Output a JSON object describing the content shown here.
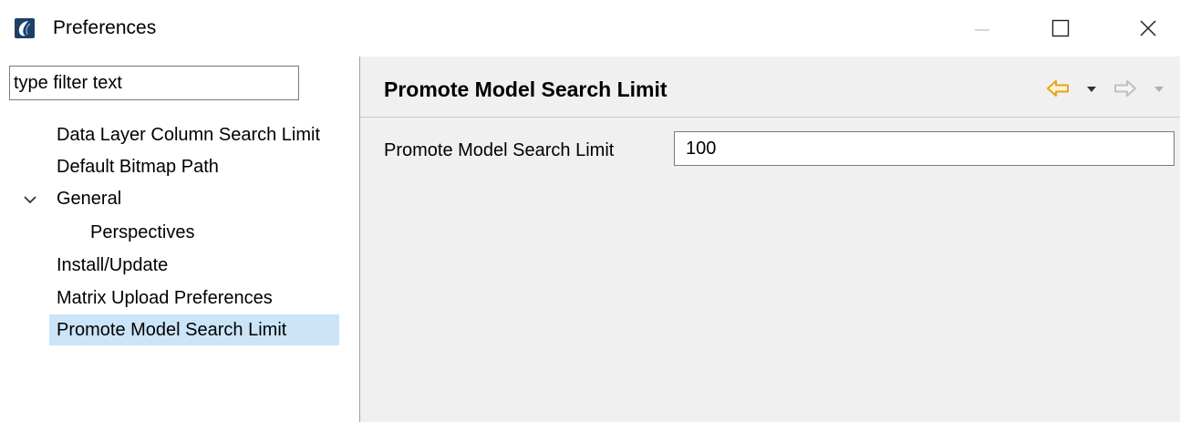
{
  "window": {
    "title": "Preferences",
    "icon": "eclipse-app-icon",
    "controls": [
      "minimize-icon",
      "maximize-icon",
      "close-icon"
    ]
  },
  "sidebar": {
    "filter_placeholder": "type filter text",
    "items": [
      {
        "label": "Data Layer Column Search Limit",
        "level": 0,
        "selected": false
      },
      {
        "label": "Default Bitmap Path",
        "level": 0,
        "selected": false
      },
      {
        "label": "General",
        "level": 0,
        "selected": false,
        "expanded": true
      },
      {
        "label": "Perspectives",
        "level": 1,
        "selected": false
      },
      {
        "label": "Install/Update",
        "level": 0,
        "selected": false
      },
      {
        "label": "Matrix Upload Preferences",
        "level": 0,
        "selected": false
      },
      {
        "label": "Promote Model Search Limit",
        "level": 0,
        "selected": true
      }
    ]
  },
  "page": {
    "title": "Promote Model Search Limit",
    "nav_icons": [
      "back-arrow-icon",
      "back-dropdown-icon",
      "forward-arrow-icon",
      "forward-dropdown-icon"
    ],
    "field": {
      "label": "Promote Model Search Limit",
      "value": "100"
    }
  },
  "colors": {
    "selection": "#cce4f7",
    "content_background": "#f0f0f0",
    "back_arrow": "#e8a317",
    "disabled": "#c0c0c0"
  }
}
